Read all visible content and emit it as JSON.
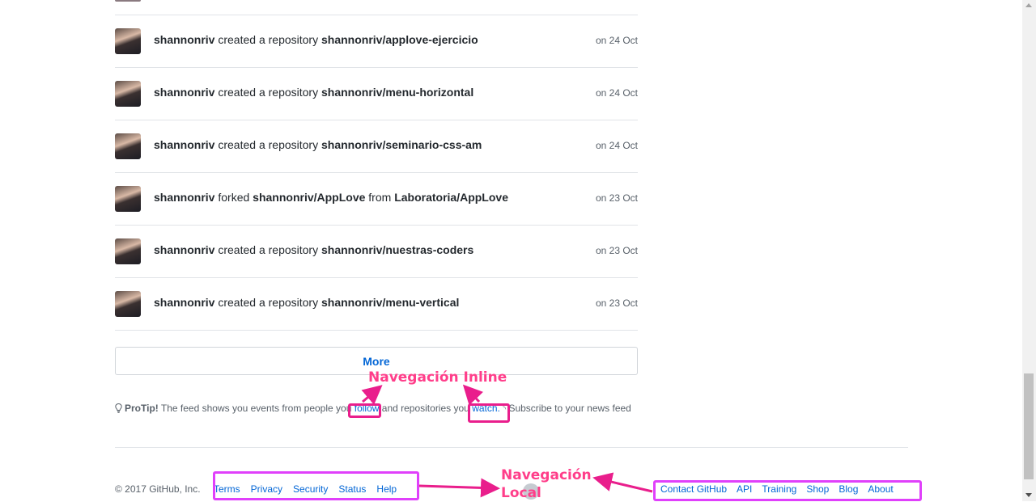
{
  "feed": {
    "events": [
      {
        "user": "shannonriv",
        "action": "created a repository",
        "repo": "shannonriv/applove-ejercicio",
        "from_label": "",
        "from_repo": "",
        "time": "on 24 Oct"
      },
      {
        "user": "shannonriv",
        "action": "created a repository",
        "repo": "shannonriv/menu-horizontal",
        "from_label": "",
        "from_repo": "",
        "time": "on 24 Oct"
      },
      {
        "user": "shannonriv",
        "action": "created a repository",
        "repo": "shannonriv/seminario-css-am",
        "from_label": "",
        "from_repo": "",
        "time": "on 24 Oct"
      },
      {
        "user": "shannonriv",
        "action": "forked",
        "repo": "shannonriv/AppLove",
        "from_label": "from",
        "from_repo": "Laboratoria/AppLove",
        "time": "on 23 Oct"
      },
      {
        "user": "shannonriv",
        "action": "created a repository",
        "repo": "shannonriv/nuestras-coders",
        "from_label": "",
        "from_repo": "",
        "time": "on 23 Oct"
      },
      {
        "user": "shannonriv",
        "action": "created a repository",
        "repo": "shannonriv/menu-vertical",
        "from_label": "",
        "from_repo": "",
        "time": "on 23 Oct"
      }
    ],
    "more_label": "More"
  },
  "protip": {
    "icon": "lightbulb-icon",
    "strong": "ProTip!",
    "text_1": "The feed shows you events from people you",
    "link_follow": "follow",
    "text_2": "and repositories you",
    "link_watch": "watch.",
    "rss_icon": "rss-icon",
    "link_subscribe": "Subscribe to your news feed"
  },
  "footer": {
    "copyright": "© 2017 GitHub, Inc.",
    "left_links": [
      "Terms",
      "Privacy",
      "Security",
      "Status",
      "Help"
    ],
    "right_links": [
      "Contact GitHub",
      "API",
      "Training",
      "Shop",
      "Blog",
      "About"
    ],
    "logo_icon": "github-mark-icon"
  },
  "annotations": {
    "inline_label": "Navegación Inline",
    "local_label_line1": "Navegación",
    "local_label_line2": "Local",
    "colors": {
      "label": "#ff3e8a",
      "box_pink": "#e91e8c",
      "box_magenta": "#e040fb"
    }
  }
}
